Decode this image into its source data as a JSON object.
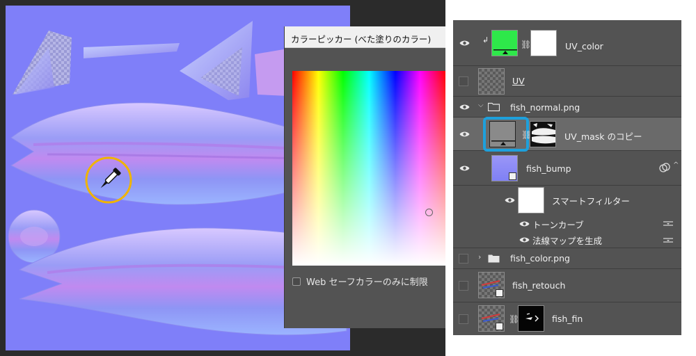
{
  "color_picker": {
    "title": "カラーピッカー (べた塗りのカラー)",
    "web_safe_label": "Web セーフカラーのみに制限",
    "web_safe_checked": false
  },
  "layers": [
    {
      "name": "UV_color",
      "visible": true,
      "clipped": true,
      "thumb_color": "#2ee84a",
      "has_mask": true
    },
    {
      "name": "UV",
      "visible": false,
      "underlined": true
    },
    {
      "name": "fish_normal.png",
      "visible": true,
      "group": true,
      "expanded": true
    },
    {
      "name": "UV_mask のコピー",
      "visible": true,
      "selected": true,
      "has_mask": true
    },
    {
      "name": "fish_bump",
      "visible": true,
      "smart_object": true
    },
    {
      "name": "スマートフィルター",
      "visible": true,
      "filter_header": true
    },
    {
      "name": "トーンカーブ",
      "visible": true,
      "filter": true
    },
    {
      "name": "法線マップを生成",
      "visible": true,
      "filter": true
    },
    {
      "name": "fish_color.png",
      "visible": false,
      "group": true,
      "expanded": false
    },
    {
      "name": "fish_retouch",
      "visible": false
    },
    {
      "name": "fish_fin",
      "visible": false,
      "has_mask": true
    }
  ],
  "colors": {
    "normal_map_base": "#7f7ff9",
    "selection_highlight": "#1ea0dc",
    "eyedropper_circle": "#f0b400"
  },
  "icons": {
    "eye": "eye-icon",
    "chain": "link-chain-icon",
    "folder": "folder-icon",
    "eyedropper": "eyedropper-icon"
  }
}
